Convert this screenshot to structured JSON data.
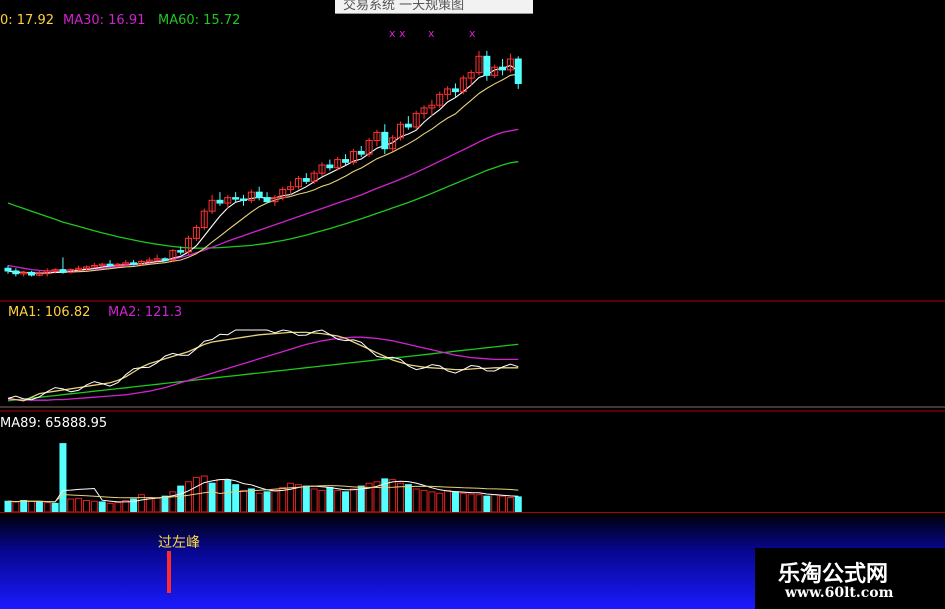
{
  "window": {
    "title": "交易系统 一天规策图"
  },
  "colors": {
    "background": "#000000",
    "up_candle": "#ff3232",
    "down_candle": "#54ffff",
    "ma_short": "#ffffff",
    "ma_mid": "#e6d27a",
    "ma30": "#d023d0",
    "ma60": "#1ec81e",
    "volume_up": "#e22222",
    "volume_down": "#54ffff",
    "divider": "#b40000",
    "signal_text": "#ffdc3c",
    "signal_bar": "#ff2a2a"
  },
  "panels": {
    "price": {
      "legend": [
        {
          "text": "0: 17.92",
          "color": "#ffd23c"
        },
        {
          "text": "MA30: 16.91",
          "color": "#d023d0"
        },
        {
          "text": "MA60: 15.72",
          "color": "#1ec81e"
        }
      ],
      "markers": [
        "x x",
        "x",
        "x"
      ]
    },
    "indicator": {
      "legend": [
        {
          "text": "MA1: 106.82",
          "color": "#ffd23c"
        },
        {
          "text": "MA2: 121.3",
          "color": "#d023d0"
        }
      ]
    },
    "volume": {
      "legend": [
        {
          "text": "MA89: 65888.95",
          "color": "#ffffff"
        }
      ]
    },
    "signal": {
      "label": "过左峰"
    }
  },
  "watermark": {
    "title": "乐淘公式网",
    "url": "www.60lt.com"
  },
  "chart_data": [
    {
      "type": "candlestick",
      "title": "",
      "legend": [
        "MA30: 16.91",
        "MA60: 15.72"
      ],
      "candles_ohlc": [
        [
          11.8,
          11.9,
          11.6,
          11.7
        ],
        [
          11.7,
          11.8,
          11.5,
          11.6
        ],
        [
          11.6,
          11.7,
          11.5,
          11.65
        ],
        [
          11.65,
          11.7,
          11.5,
          11.55
        ],
        [
          11.55,
          11.7,
          11.5,
          11.6
        ],
        [
          11.6,
          11.8,
          11.5,
          11.7
        ],
        [
          11.7,
          11.8,
          11.6,
          11.75
        ],
        [
          11.75,
          12.2,
          11.6,
          11.65
        ],
        [
          11.65,
          11.8,
          11.6,
          11.75
        ],
        [
          11.75,
          11.9,
          11.7,
          11.8
        ],
        [
          11.8,
          11.9,
          11.7,
          11.85
        ],
        [
          11.85,
          12.0,
          11.8,
          11.9
        ],
        [
          11.9,
          12.0,
          11.85,
          11.95
        ],
        [
          11.95,
          12.1,
          11.85,
          11.9
        ],
        [
          11.9,
          12.0,
          11.85,
          11.95
        ],
        [
          11.95,
          12.1,
          11.9,
          12.0
        ],
        [
          12.0,
          12.1,
          11.9,
          11.95
        ],
        [
          11.95,
          12.1,
          11.9,
          12.05
        ],
        [
          12.05,
          12.2,
          12.0,
          12.1
        ],
        [
          12.1,
          12.3,
          12.05,
          12.15
        ],
        [
          12.15,
          12.2,
          12.05,
          12.1
        ],
        [
          12.1,
          12.5,
          12.05,
          12.45
        ],
        [
          12.45,
          12.6,
          12.3,
          12.4
        ],
        [
          12.4,
          13.0,
          12.3,
          12.9
        ],
        [
          12.9,
          13.4,
          12.8,
          13.3
        ],
        [
          13.3,
          14.0,
          13.2,
          13.9
        ],
        [
          13.9,
          14.5,
          13.8,
          14.3
        ],
        [
          14.3,
          14.6,
          14.1,
          14.2
        ],
        [
          14.2,
          14.5,
          14.0,
          14.4
        ],
        [
          14.4,
          14.6,
          14.2,
          14.35
        ],
        [
          14.35,
          14.5,
          14.1,
          14.3
        ],
        [
          14.3,
          14.7,
          14.2,
          14.6
        ],
        [
          14.6,
          14.8,
          14.3,
          14.4
        ],
        [
          14.4,
          14.6,
          14.2,
          14.25
        ],
        [
          14.25,
          14.5,
          14.1,
          14.4
        ],
        [
          14.4,
          14.8,
          14.3,
          14.7
        ],
        [
          14.7,
          15.0,
          14.5,
          14.8
        ],
        [
          14.8,
          15.2,
          14.7,
          15.1
        ],
        [
          15.1,
          15.3,
          14.9,
          15.0
        ],
        [
          15.0,
          15.4,
          14.9,
          15.3
        ],
        [
          15.3,
          15.7,
          15.2,
          15.6
        ],
        [
          15.6,
          15.8,
          15.4,
          15.5
        ],
        [
          15.5,
          15.9,
          15.4,
          15.8
        ],
        [
          15.8,
          16.0,
          15.6,
          15.7
        ],
        [
          15.7,
          16.2,
          15.6,
          16.1
        ],
        [
          16.1,
          16.3,
          15.9,
          16.0
        ],
        [
          16.0,
          16.6,
          15.9,
          16.5
        ],
        [
          16.5,
          16.9,
          16.3,
          16.8
        ],
        [
          16.8,
          17.1,
          16.0,
          16.2
        ],
        [
          16.2,
          16.7,
          16.1,
          16.6
        ],
        [
          16.6,
          17.2,
          16.5,
          17.1
        ],
        [
          17.1,
          17.4,
          16.9,
          17.0
        ],
        [
          17.0,
          17.6,
          16.9,
          17.5
        ],
        [
          17.5,
          17.8,
          17.3,
          17.7
        ],
        [
          17.7,
          18.0,
          17.4,
          17.8
        ],
        [
          17.8,
          18.3,
          17.7,
          18.2
        ],
        [
          18.2,
          18.5,
          18.0,
          18.4
        ],
        [
          18.4,
          18.6,
          18.1,
          18.3
        ],
        [
          18.3,
          18.9,
          18.2,
          18.8
        ],
        [
          18.8,
          19.1,
          18.5,
          19.0
        ],
        [
          19.0,
          19.8,
          18.9,
          19.6
        ],
        [
          19.6,
          19.8,
          18.7,
          18.9
        ],
        [
          18.9,
          19.3,
          18.8,
          19.2
        ],
        [
          19.2,
          19.5,
          18.9,
          19.1
        ],
        [
          19.1,
          19.7,
          19.0,
          19.5
        ],
        [
          19.5,
          19.6,
          18.4,
          18.6
        ]
      ],
      "ma30": [
        11.9,
        11.85,
        11.8,
        11.75,
        11.72,
        11.7,
        11.7,
        11.7,
        11.7,
        11.72,
        11.75,
        11.78,
        11.8,
        11.83,
        11.86,
        11.9,
        11.93,
        11.96,
        12.0,
        12.04,
        12.08,
        12.13,
        12.2,
        12.28,
        12.37,
        12.47,
        12.57,
        12.68,
        12.8,
        12.9,
        13.0,
        13.1,
        13.2,
        13.3,
        13.4,
        13.5,
        13.6,
        13.7,
        13.8,
        13.9,
        14.0,
        14.1,
        14.2,
        14.3,
        14.4,
        14.5,
        14.62,
        14.74,
        14.85,
        14.96,
        15.08,
        15.2,
        15.33,
        15.46,
        15.6,
        15.74,
        15.88,
        16.02,
        16.16,
        16.3,
        16.45,
        16.58,
        16.7,
        16.8,
        16.86,
        16.91
      ],
      "ma60": [
        14.2,
        14.1,
        14.0,
        13.9,
        13.8,
        13.7,
        13.6,
        13.5,
        13.42,
        13.34,
        13.26,
        13.18,
        13.1,
        13.03,
        12.96,
        12.9,
        12.84,
        12.78,
        12.73,
        12.68,
        12.64,
        12.6,
        12.57,
        12.55,
        12.54,
        12.54,
        12.55,
        12.56,
        12.58,
        12.6,
        12.62,
        12.64,
        12.68,
        12.72,
        12.77,
        12.82,
        12.88,
        12.95,
        13.02,
        13.1,
        13.18,
        13.26,
        13.35,
        13.44,
        13.53,
        13.62,
        13.72,
        13.82,
        13.92,
        14.02,
        14.12,
        14.22,
        14.33,
        14.44,
        14.56,
        14.68,
        14.8,
        14.92,
        15.04,
        15.16,
        15.28,
        15.4,
        15.5,
        15.6,
        15.68,
        15.72
      ]
    },
    {
      "type": "line",
      "title": "",
      "legend": [
        "MA1: 106.82",
        "MA2: 121.3"
      ],
      "series": [
        {
          "name": "MA1",
          "values": [
            56,
            54,
            52,
            58,
            64,
            66,
            68,
            70,
            72,
            74,
            76,
            78,
            80,
            82,
            86,
            92,
            100,
            108,
            114,
            118,
            122,
            126,
            130,
            134,
            140,
            146,
            150,
            152,
            154,
            156,
            158,
            160,
            162,
            163,
            164,
            165,
            166,
            166,
            166,
            165,
            164,
            162,
            160,
            156,
            150,
            144,
            138,
            132,
            126,
            120,
            116,
            112,
            110,
            108,
            107,
            106,
            105,
            104,
            104,
            105,
            106,
            106,
            107,
            107,
            107,
            107
          ]
        },
        {
          "name": "MA2",
          "values": [
            54,
            54,
            53,
            53,
            53,
            53,
            54,
            54,
            55,
            56,
            57,
            58,
            59,
            60,
            61,
            62,
            64,
            66,
            68,
            71,
            74,
            78,
            82,
            86,
            90,
            94,
            98,
            102,
            106,
            110,
            114,
            118,
            122,
            126,
            130,
            134,
            138,
            142,
            146,
            149,
            152,
            154,
            156,
            157,
            158,
            158,
            157,
            156,
            154,
            152,
            149,
            146,
            143,
            140,
            137,
            134,
            131,
            128,
            126,
            124,
            123,
            122,
            121,
            121,
            121,
            121
          ]
        }
      ]
    },
    {
      "type": "bar",
      "title": "",
      "legend": [
        "MA89: 65888.95"
      ],
      "values": [
        15,
        14,
        16,
        15,
        14,
        13,
        12,
        95,
        18,
        19,
        16,
        15,
        14,
        12,
        13,
        16,
        18,
        24,
        20,
        19,
        22,
        28,
        36,
        42,
        48,
        50,
        40,
        45,
        44,
        38,
        30,
        32,
        26,
        28,
        30,
        34,
        40,
        38,
        36,
        32,
        30,
        34,
        30,
        28,
        32,
        36,
        40,
        42,
        46,
        45,
        40,
        38,
        32,
        30,
        28,
        26,
        30,
        28,
        26,
        25,
        24,
        22,
        24,
        22,
        20,
        21
      ],
      "up": [
        false,
        true,
        false,
        true,
        false,
        true,
        false,
        false,
        true,
        true,
        true,
        true,
        false,
        true,
        true,
        true,
        false,
        true,
        true,
        true,
        false,
        true,
        false,
        true,
        true,
        true,
        false,
        true,
        false,
        false,
        true,
        false,
        true,
        false,
        true,
        true,
        true,
        true,
        false,
        true,
        true,
        false,
        true,
        false,
        true,
        false,
        true,
        true,
        false,
        true,
        true,
        false,
        true,
        true,
        true,
        true,
        true,
        false,
        true,
        true,
        true,
        false,
        true,
        true,
        true,
        false
      ]
    }
  ]
}
